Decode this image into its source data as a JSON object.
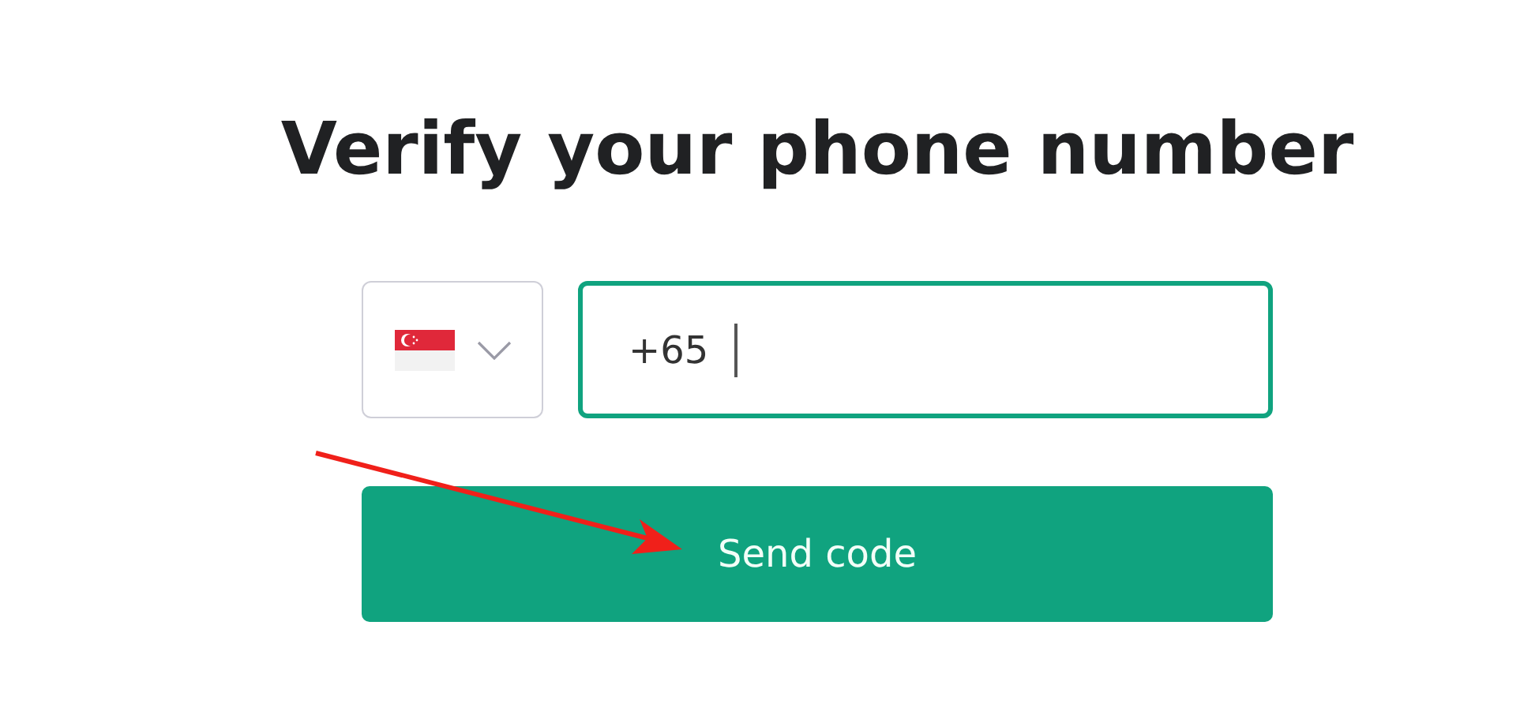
{
  "title": "Verify your phone number",
  "country_select": {
    "expanded": false
  },
  "phone_field": {
    "value": "+65",
    "focused": true
  },
  "send_button": {
    "label": "Send code"
  }
}
